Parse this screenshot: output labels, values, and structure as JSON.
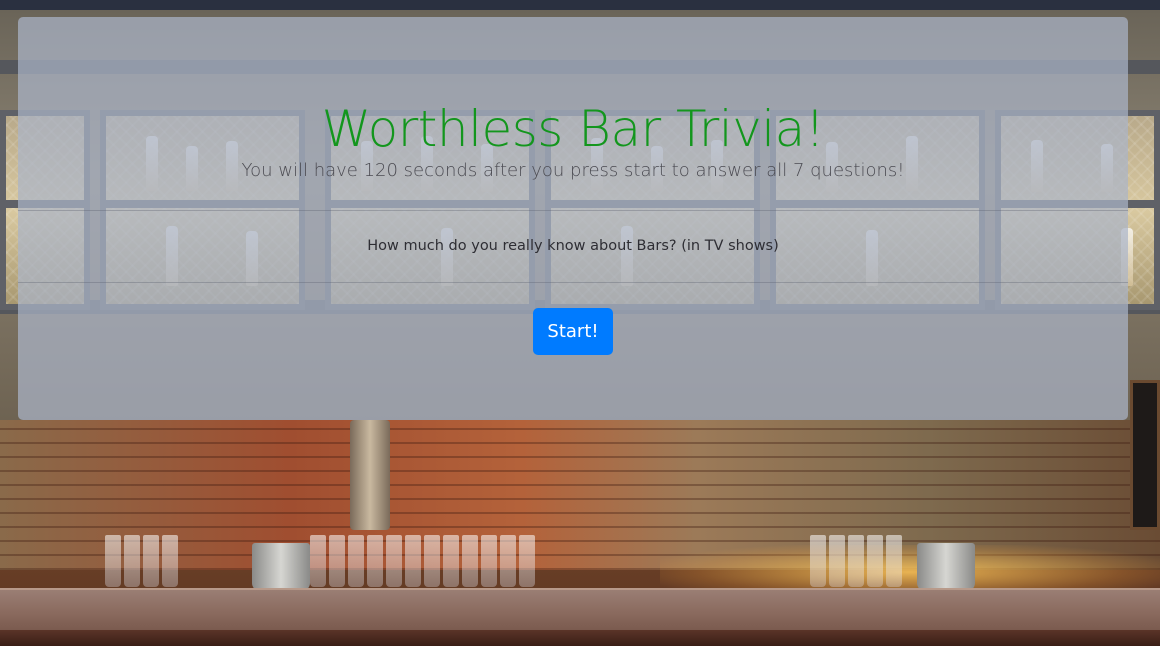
{
  "page": {
    "title": "Worthless Bar Trivia!",
    "subtitle": "You will have 120 seconds after you press start to answer all 7 questions!",
    "lead": "How much do you really know about Bars? (in TV shows)",
    "start_label": "Start!"
  },
  "colors": {
    "title": "#13961d",
    "button": "#007bff",
    "panel": "rgba(170,180,200,0.72)"
  }
}
